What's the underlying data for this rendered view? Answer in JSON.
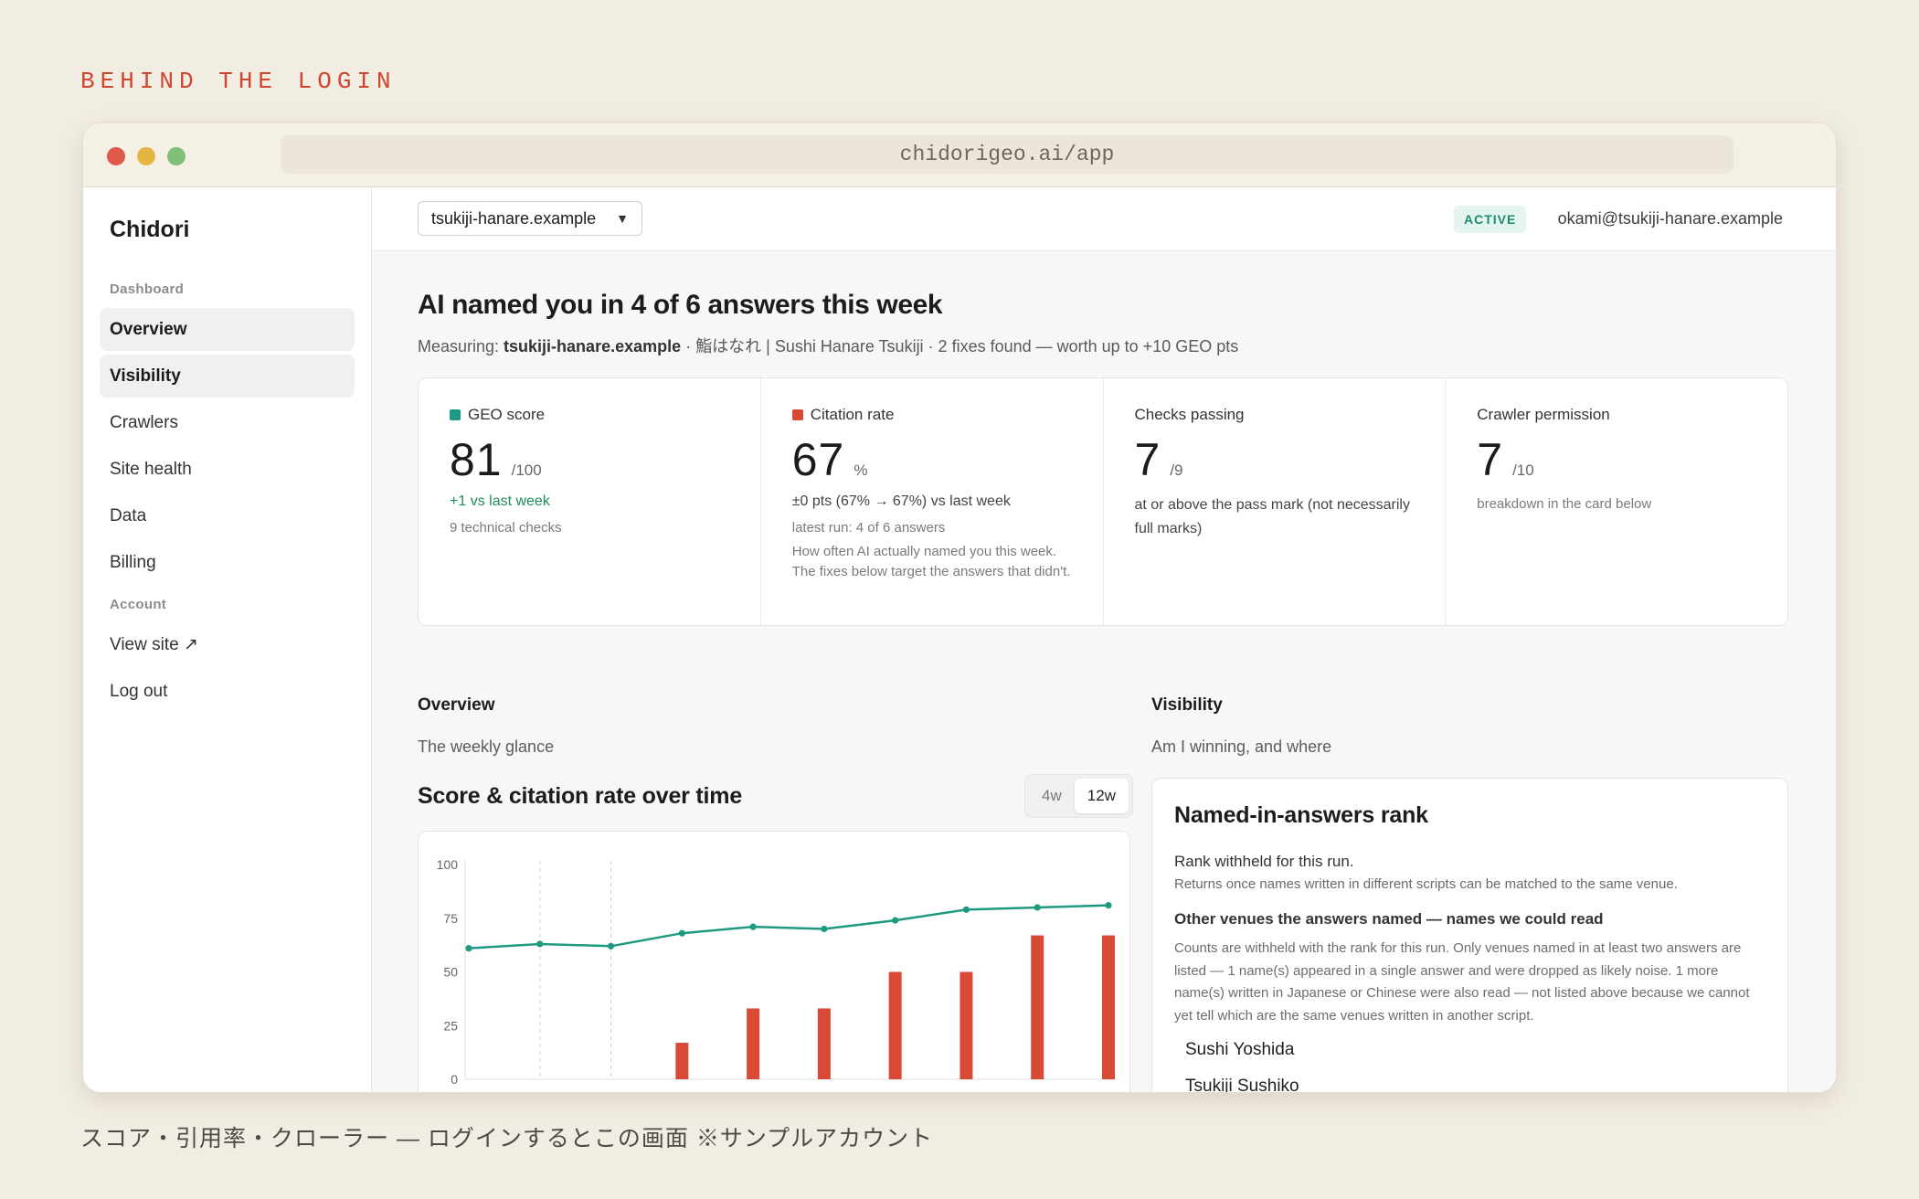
{
  "page": {
    "eyebrow": "BEHIND THE LOGIN",
    "caption": "スコア・引用率・クローラー ― ログインするとこの画面 ※サンプルアカウント"
  },
  "browser": {
    "url": "chidorigeo.ai/app"
  },
  "sidebar": {
    "brand": "Chidori",
    "section_dashboard": "Dashboard",
    "items": [
      {
        "label": "Overview"
      },
      {
        "label": "Visibility"
      },
      {
        "label": "Crawlers"
      },
      {
        "label": "Site health"
      },
      {
        "label": "Data"
      },
      {
        "label": "Billing"
      }
    ],
    "section_account": "Account",
    "account_items": [
      {
        "label": "View site ↗"
      },
      {
        "label": "Log out"
      }
    ]
  },
  "topbar": {
    "site": "tsukiji-hanare.example",
    "status": "ACTIVE",
    "email": "okami@tsukiji-hanare.example"
  },
  "header": {
    "headline": "AI named you in 4 of 6 answers this week",
    "measuring_prefix": "Measuring: ",
    "measuring_site": "tsukiji-hanare.example",
    "measuring_rest": " · 鮨はなれ | Sushi Hanare Tsukiji · 2 fixes found — worth up to +10 GEO pts"
  },
  "metrics": {
    "geo": {
      "label": "GEO score",
      "value": "81",
      "unit": "/100",
      "delta": "+1 vs last week",
      "note": "9 technical checks"
    },
    "citation": {
      "label": "Citation rate",
      "value": "67",
      "unit": "%",
      "delta": "±0 pts (67% → 67%) vs last week",
      "note": "latest run: 4 of 6 answers",
      "desc": "How often AI actually named you this week. The fixes below target the answers that didn't."
    },
    "checks": {
      "label": "Checks passing",
      "value": "7",
      "unit": "/9",
      "sub": "at or above the pass mark (not necessarily full marks)"
    },
    "crawler": {
      "label": "Crawler permission",
      "value": "7",
      "unit": "/10",
      "note": "breakdown in the card below"
    }
  },
  "overview": {
    "title": "Overview",
    "subtitle": "The weekly glance"
  },
  "visibility": {
    "title": "Visibility",
    "subtitle": "Am I winning, and where"
  },
  "chart": {
    "title": "Score & citation rate over time",
    "ranges": [
      {
        "label": "4w"
      },
      {
        "label": "12w"
      }
    ],
    "selected_range": "12w"
  },
  "chart_data": {
    "type": "bar",
    "title": "Score & citation rate over time",
    "ylim": [
      0,
      100
    ],
    "yticks": [
      0,
      25,
      50,
      75,
      100
    ],
    "grid": true,
    "series": [
      {
        "type": "line",
        "color": "#1e9a82",
        "values": [
          61,
          63,
          62,
          68,
          71,
          70,
          74,
          79,
          80,
          81
        ]
      },
      {
        "type": "bar",
        "color": "#d84a36",
        "values": [
          0,
          0,
          0,
          17,
          33,
          33,
          50,
          50,
          67,
          67
        ]
      }
    ],
    "colors": {
      "line": "#1e9a82",
      "bar": "#d84a36"
    }
  },
  "rank": {
    "title": "Named-in-answers rank",
    "withheld": "Rank withheld for this run.",
    "return_note": "Returns once names written in different scripts can be matched to the same venue.",
    "others_heading": "Other venues the answers named — names we could read",
    "counts_note": "Counts are withheld with the rank for this run. Only venues named in at least two answers are listed — 1 name(s) appeared in a single answer and were dropped as likely noise. 1 more name(s) written in Japanese or Chinese were also read — not listed above because we cannot yet tell which are the same venues written in another script.",
    "venues": [
      {
        "name": "Sushi Yoshida"
      },
      {
        "name": "Tsukiji Sushiko"
      }
    ]
  },
  "colors": {
    "accent": "#d0452e",
    "teal": "#1e9a82",
    "red": "#d84a36",
    "active_badge_bg": "#e4f4ef"
  }
}
